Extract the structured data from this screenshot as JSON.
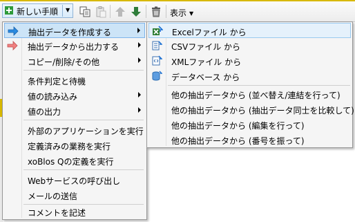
{
  "toolbar": {
    "new_procedure_label": "新しい手順",
    "view_label": "表示",
    "accent_color": "#1a6fd1",
    "buttons": [
      "copy-icon",
      "paste-icon",
      "move-up-icon",
      "move-down-icon",
      "trash-icon"
    ]
  },
  "main_menu": {
    "items": [
      {
        "label": "抽出データを作成する",
        "submenu": true,
        "icon": "blue-arrow-icon"
      },
      {
        "label": "抽出データから出力する",
        "submenu": true,
        "icon": "red-arrow-icon"
      },
      {
        "label": "コピー/削除/その他",
        "submenu": true
      },
      {
        "label": "条件判定と待機",
        "submenu": false
      },
      {
        "label": "値の読み込み",
        "submenu": true
      },
      {
        "label": "値の出力",
        "submenu": true
      },
      {
        "label": "外部のアプリケーションを実行",
        "submenu": false
      },
      {
        "label": "定義済みの業務を実行",
        "submenu": false
      },
      {
        "label": "xoBlos Qの定義を実行",
        "submenu": false
      },
      {
        "label": "Webサービスの呼び出し",
        "submenu": false
      },
      {
        "label": "メールの送信",
        "submenu": false
      },
      {
        "label": "コメントを記述",
        "submenu": false
      }
    ]
  },
  "sub_menu": {
    "items": [
      {
        "label": "Excelファイル から",
        "icon": "excel-icon"
      },
      {
        "label": "CSVファイル から",
        "icon": "csv-icon"
      },
      {
        "label": "XMLファイル から",
        "icon": "xml-icon"
      },
      {
        "label": "データベース から",
        "icon": "database-icon"
      },
      {
        "label": "他の抽出データから (並べ替え/連結を行って)"
      },
      {
        "label": "他の抽出データから (抽出データ同士を比較して)"
      },
      {
        "label": "他の抽出データから (編集を行って)"
      },
      {
        "label": "他の抽出データから (番号を振って)"
      }
    ]
  }
}
